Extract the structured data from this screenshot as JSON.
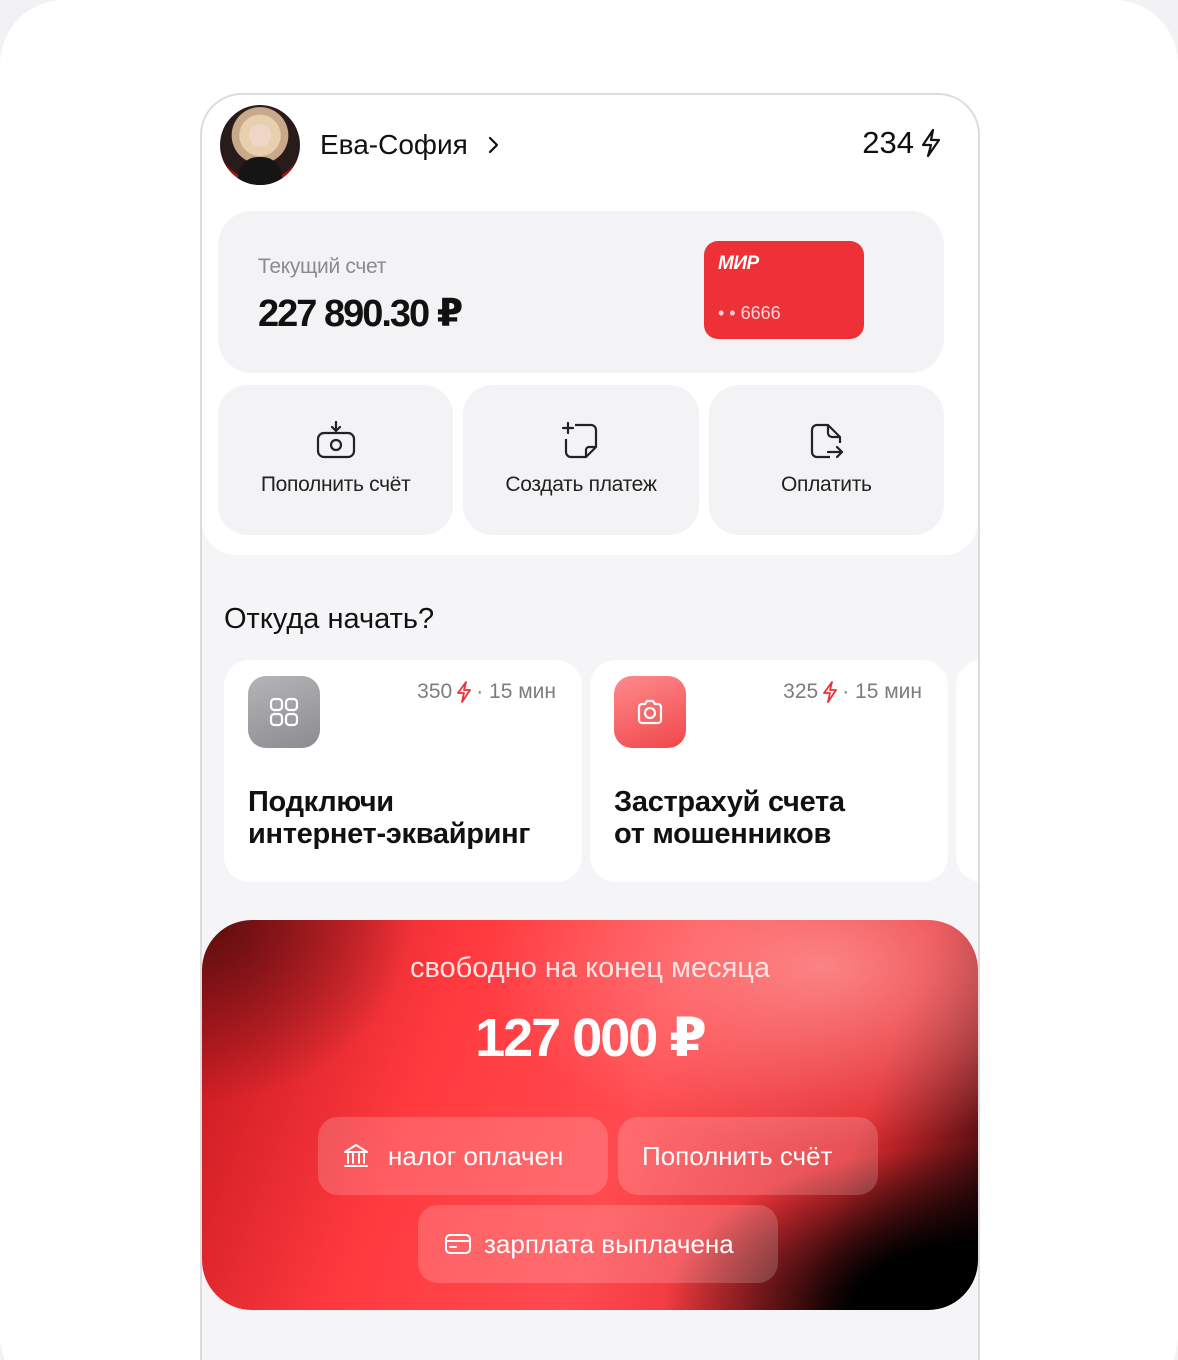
{
  "profile": {
    "name": "Ева-София",
    "points": "234"
  },
  "account": {
    "label": "Текущий счет",
    "balance": "227 890.30 ₽",
    "card_brand": "МИР",
    "card_number": "• • 6666"
  },
  "actions": [
    {
      "label": "Пополнить счёт",
      "icon": "wallet-download-icon"
    },
    {
      "label": "Создать платеж",
      "icon": "document-plus-icon"
    },
    {
      "label": "Оплатить",
      "icon": "document-arrow-icon"
    }
  ],
  "start_section": {
    "title": "Откуда начать?",
    "promos": [
      {
        "points": "350",
        "duration": "· 15 мин",
        "title_line1": "Подключи",
        "title_line2": "интернет-эквайринг",
        "icon": "grid-icon"
      },
      {
        "points": "325",
        "duration": "· 15 мин",
        "title_line1": "Застрахуй счета",
        "title_line2": "от мошенников",
        "icon": "camera-icon"
      }
    ]
  },
  "forecast": {
    "label": "свободно на конец месяца",
    "amount": "127 000 ₽",
    "chips": [
      {
        "label": "налог оплачен",
        "icon": "bank-icon"
      },
      {
        "label": "Пополнить счёт"
      },
      {
        "label": "зарплата выплачена",
        "icon": "card-icon"
      }
    ]
  },
  "colors": {
    "accent_red": "#ee3136",
    "background": "#f5f5f7"
  }
}
